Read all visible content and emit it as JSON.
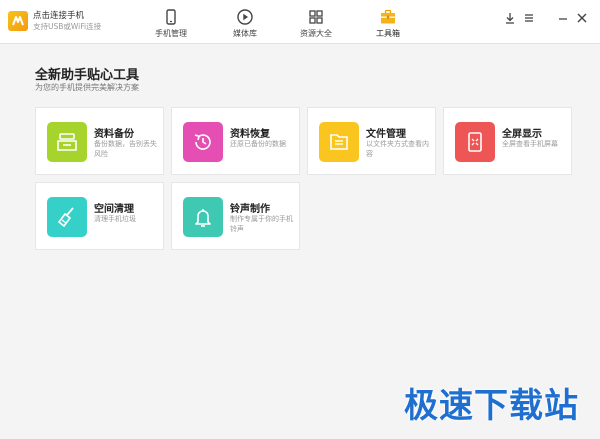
{
  "app": {
    "title": "点击连接手机",
    "subtitle": "支持USB或WiFi连接"
  },
  "nav": [
    {
      "label": "手机管理",
      "icon": "phone-icon"
    },
    {
      "label": "媒体库",
      "icon": "play-circle-icon"
    },
    {
      "label": "资源大全",
      "icon": "grid-icon"
    },
    {
      "label": "工具箱",
      "icon": "toolbox-icon",
      "active": true
    }
  ],
  "window_controls": [
    "download-icon",
    "menu-icon",
    "minimize-icon",
    "close-icon"
  ],
  "page": {
    "title": "全新助手贴心工具",
    "subtitle": "为您的手机提供完美解决方案"
  },
  "tools": [
    {
      "title": "资料备份",
      "desc": "备份数据，告别丢失风险",
      "icon": "backup-icon",
      "color": "#a6d32c"
    },
    {
      "title": "资料恢复",
      "desc": "还原已备份的数据",
      "icon": "restore-clock-icon",
      "color": "#e54fb4"
    },
    {
      "title": "文件管理",
      "desc": "以文件夹方式查看内容",
      "icon": "folder-icon",
      "color": "#f9c51e"
    },
    {
      "title": "全屏显示",
      "desc": "全屏查看手机屏幕",
      "icon": "fullscreen-phone-icon",
      "color": "#ee5555"
    },
    {
      "title": "空间清理",
      "desc": "清理手机垃圾",
      "icon": "broom-icon",
      "color": "#35d1c9"
    },
    {
      "title": "铃声制作",
      "desc": "制作专属于你的手机铃声",
      "icon": "bell-icon",
      "color": "#40c9b2"
    }
  ],
  "watermark": "极速下载站"
}
